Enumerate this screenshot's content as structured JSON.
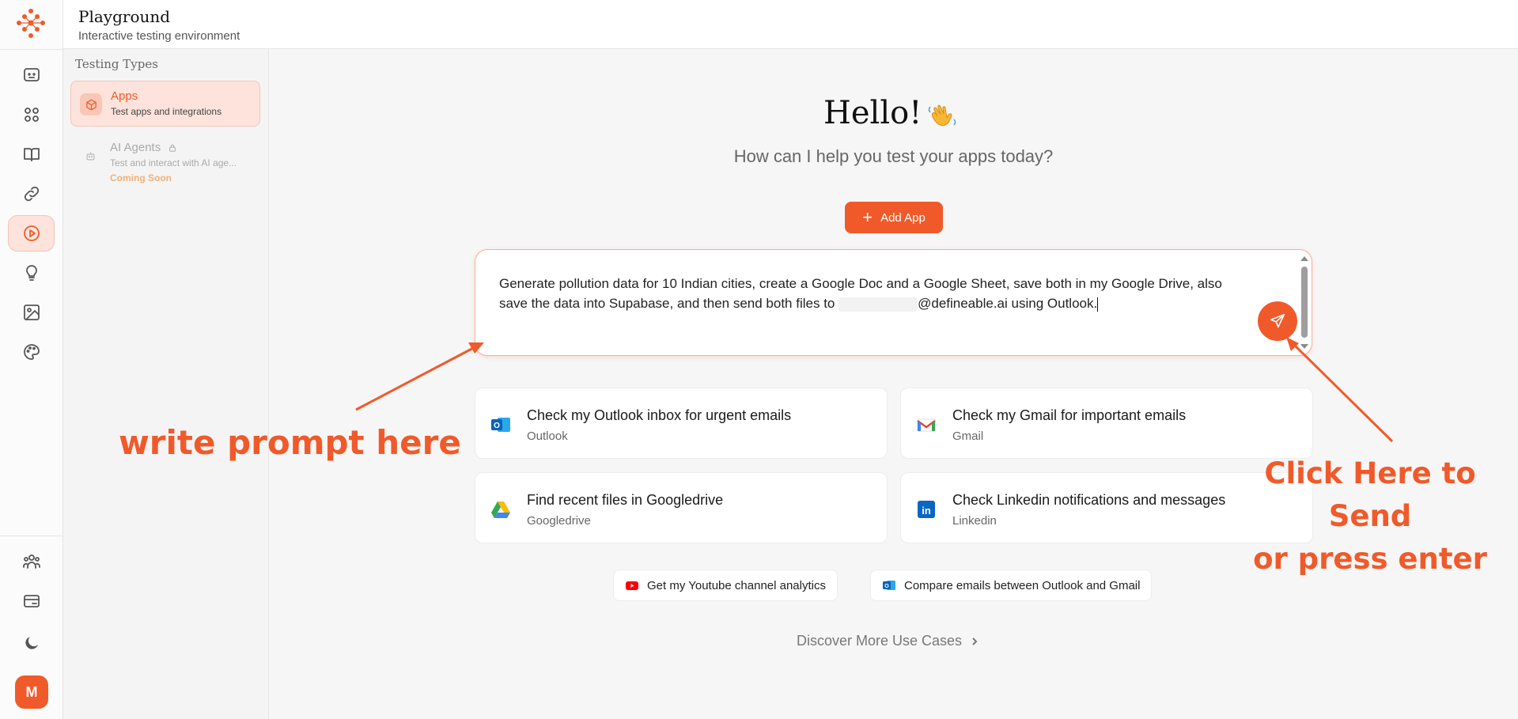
{
  "app": {
    "title": "Playground",
    "subtitle": "Interactive testing environment"
  },
  "rail": {
    "items": [
      "chat-icon",
      "apps-grid-icon",
      "book-icon",
      "link-icon",
      "play-icon",
      "bulb-icon",
      "image-icon",
      "palette-icon"
    ],
    "active": "play-icon",
    "bottom_items": [
      "team-icon",
      "billing-icon",
      "moon-icon"
    ],
    "avatar_initial": "M"
  },
  "sidebar": {
    "heading": "Testing Types",
    "items": [
      {
        "label": "Apps",
        "description": "Test apps and integrations",
        "active": true
      },
      {
        "label": "AI Agents",
        "description": "Test and interact with AI age...",
        "badge": "Coming Soon",
        "locked": true
      }
    ]
  },
  "main": {
    "greeting": "Hello!",
    "tagline": "How can I help you test your apps today?",
    "add_app_label": "Add App",
    "prompt": {
      "line1": "Generate pollution data for 10 Indian cities, create a Google Doc and a Google Sheet, save both in my Google",
      "line2_before": "Drive, also save the data into Supabase, and then send both files to",
      "line2_after": "@defineable.ai using",
      "line3": "Outlook."
    },
    "suggestions": [
      {
        "title": "Check my Outlook inbox for urgent emails",
        "app": "Outlook",
        "icon": "outlook-icon"
      },
      {
        "title": "Check my Gmail for important emails",
        "app": "Gmail",
        "icon": "gmail-icon"
      },
      {
        "title": "Find recent files in Googledrive",
        "app": "Googledrive",
        "icon": "google-drive-icon"
      },
      {
        "title": "Check Linkedin notifications and messages",
        "app": "Linkedin",
        "icon": "linkedin-icon"
      }
    ],
    "chips": [
      {
        "label": "Get my Youtube channel analytics",
        "icon": "youtube-icon"
      },
      {
        "label": "Compare emails between Outlook and Gmail",
        "icon": "outlook-icon"
      }
    ],
    "discover_label": "Discover More Use Cases"
  },
  "annotations": {
    "left": "write prompt here",
    "right_line1": "Click Here to Send",
    "right_line2": "or press enter"
  },
  "colors": {
    "accent": "#f05a2a",
    "accent_light": "#fde3db"
  }
}
